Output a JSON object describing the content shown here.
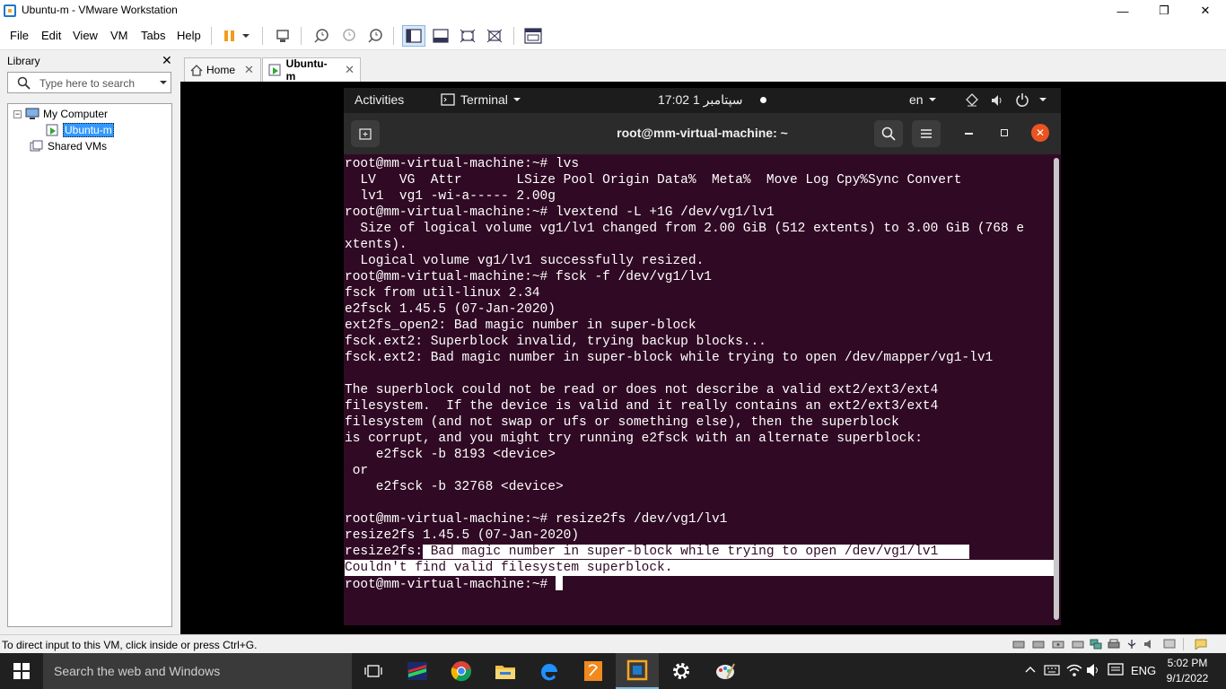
{
  "window": {
    "title": "Ubuntu-m - VMware Workstation",
    "minimize": "—",
    "maximize": "❐",
    "close": "✕"
  },
  "menu": {
    "file": "File",
    "edit": "Edit",
    "view": "View",
    "vm": "VM",
    "tabs": "Tabs",
    "help": "Help"
  },
  "library": {
    "title": "Library",
    "close": "✕",
    "search_placeholder": "Type here to search",
    "tree": {
      "my_computer": "My Computer",
      "vm": "Ubuntu-m",
      "shared": "Shared VMs"
    }
  },
  "tabs": [
    {
      "label": "Home",
      "close": "✕"
    },
    {
      "label": "Ubuntu-m",
      "close": "✕"
    }
  ],
  "gnome": {
    "activities": "Activities",
    "app": "Terminal",
    "clock": "17:02  سپتامبر 1",
    "lang": "en"
  },
  "terminal": {
    "title": "root@mm-virtual-machine: ~",
    "lines": [
      "root@mm-virtual-machine:~# lvs",
      "  LV   VG  Attr       LSize Pool Origin Data%  Meta%  Move Log Cpy%Sync Convert",
      "  lv1  vg1 -wi-a----- 2.00g",
      "root@mm-virtual-machine:~# lvextend -L +1G /dev/vg1/lv1",
      "  Size of logical volume vg1/lv1 changed from 2.00 GiB (512 extents) to 3.00 GiB (768 e",
      "xtents).",
      "  Logical volume vg1/lv1 successfully resized.",
      "root@mm-virtual-machine:~# fsck -f /dev/vg1/lv1",
      "fsck from util-linux 2.34",
      "e2fsck 1.45.5 (07-Jan-2020)",
      "ext2fs_open2: Bad magic number in super-block",
      "fsck.ext2: Superblock invalid, trying backup blocks...",
      "fsck.ext2: Bad magic number in super-block while trying to open /dev/mapper/vg1-lv1",
      "",
      "The superblock could not be read or does not describe a valid ext2/ext3/ext4",
      "filesystem.  If the device is valid and it really contains an ext2/ext3/ext4",
      "filesystem (and not swap or ufs or something else), then the superblock",
      "is corrupt, and you might try running e2fsck with an alternate superblock:",
      "    e2fsck -b 8193 <device>",
      " or",
      "    e2fsck -b 32768 <device>",
      "",
      "root@mm-virtual-machine:~# resize2fs /dev/vg1/lv1",
      "resize2fs 1.45.5 (07-Jan-2020)"
    ],
    "hl_line1_prefix": "resize2fs:",
    "hl_line1_rest": " Bad magic number in super-block while trying to open /dev/vg1/lv1    ",
    "hl_line2": "Couldn't find valid filesystem superblock.                                      ",
    "prompt": "root@mm-virtual-machine:~# "
  },
  "statusbar": {
    "message": "To direct input to this VM, click inside or press Ctrl+G."
  },
  "taskbar": {
    "search_placeholder": "Search the web and Windows",
    "lang": "ENG",
    "time": "5:02 PM",
    "date": "9/1/2022"
  }
}
